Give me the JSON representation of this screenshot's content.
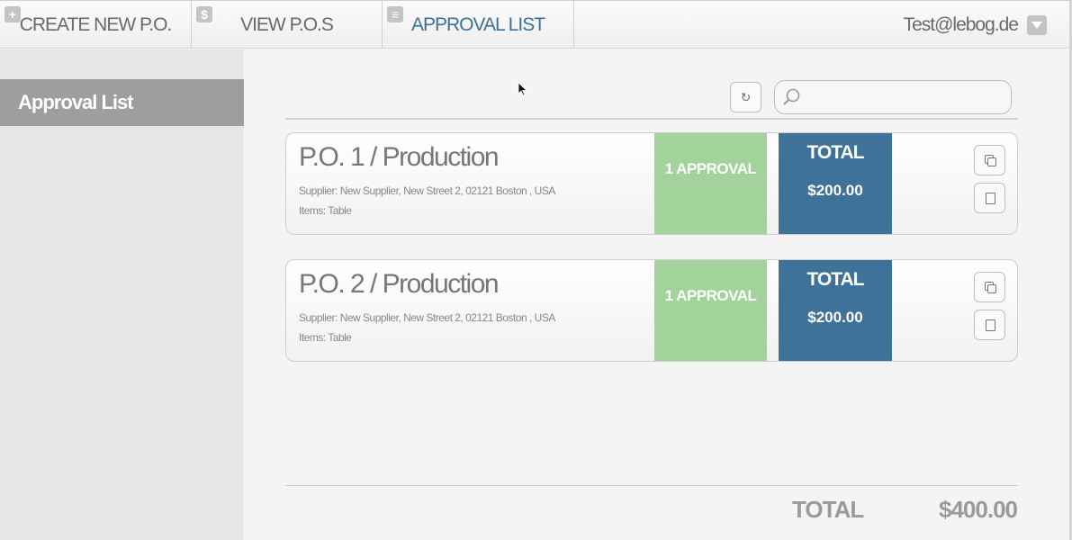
{
  "nav": {
    "tabs": [
      {
        "label": "CREATE NEW P.O.",
        "icon": "plus-icon",
        "active": false
      },
      {
        "label": "VIEW P.O.S",
        "icon": "dollar-icon",
        "active": false
      },
      {
        "label": "APPROVAL LIST",
        "icon": "list-icon",
        "active": true
      }
    ],
    "user": "Test@lebog.de"
  },
  "sidebar": {
    "items": [
      {
        "label": "Approval List",
        "active": true
      }
    ]
  },
  "search": {
    "placeholder": "",
    "value": ""
  },
  "orders": [
    {
      "title": "P.O. 1 / Production",
      "supplier": "Supplier: New Supplier, New Street 2, 02121 Boston , USA",
      "items": "Items: Table",
      "approval": "1 APPROVAL",
      "total_label": "TOTAL",
      "total_value": "$200.00"
    },
    {
      "title": "P.O. 2 / Production",
      "supplier": "Supplier: New Supplier, New Street 2, 02121 Boston , USA",
      "items": "Items: Table",
      "approval": "1 APPROVAL",
      "total_label": "TOTAL",
      "total_value": "$200.00"
    }
  ],
  "summary": {
    "label": "TOTAL",
    "value": "$400.00"
  },
  "colors": {
    "accent": "#3e7298",
    "approval": "#a2d39a",
    "active_tab": "#3e7194"
  }
}
